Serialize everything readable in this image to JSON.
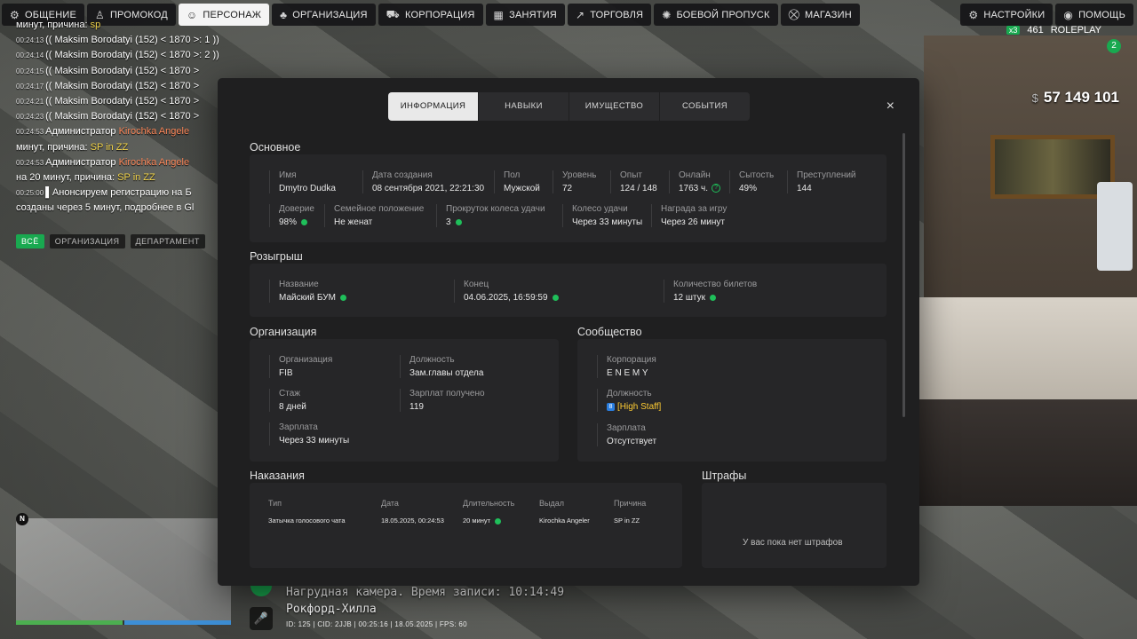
{
  "topbar": {
    "left": [
      {
        "icon": "chat-icon",
        "label": "ОБЩЕНИЕ"
      },
      {
        "icon": "promo-icon",
        "label": "ПРОМОКОД"
      },
      {
        "icon": "user-icon",
        "label": "ПЕРСОНАЖ",
        "active": true
      },
      {
        "icon": "org-icon",
        "label": "ОРГАНИЗАЦИЯ"
      },
      {
        "icon": "car-icon",
        "label": "КОРПОРАЦИЯ"
      },
      {
        "icon": "calendar-icon",
        "label": "ЗАНЯТИЯ"
      },
      {
        "icon": "chart-icon",
        "label": "ТОРГОВЛЯ"
      },
      {
        "icon": "gear-badge-icon",
        "label": "БОЕВОЙ ПРОПУСК"
      },
      {
        "icon": "cart-icon",
        "label": "МАГАЗИН"
      }
    ],
    "right": [
      {
        "icon": "settings-icon",
        "label": "НАСТРОЙКИ"
      },
      {
        "icon": "help-icon",
        "label": "ПОМОЩЬ"
      }
    ]
  },
  "hud": {
    "money_currency": "$",
    "money": "57 149 101",
    "online_left": "x3",
    "online": "461",
    "brand": "ROLEPLAY",
    "badge": "2",
    "bodycam": "Нагрудная камера. Время записи: 10:14:49",
    "location": "Рокфорд-Хилла",
    "sysline": "ID: 125 | CID: 2JJB | 00:25:16 | 18.05.2025 | FPS: 60"
  },
  "chat": {
    "lines": [
      {
        "ts": "",
        "pre": "",
        "mid": "",
        "post": "минут, причина: ",
        "hl": "sp"
      },
      {
        "ts": "00:24:13",
        "pre": "(( Maksim Borodatyi (152) < 1870 >: 1 ))",
        "mid": "",
        "post": "",
        "hl": ""
      },
      {
        "ts": "00:24:14",
        "pre": "(( Maksim Borodatyi (152) < 1870 >: 2 ))",
        "mid": "",
        "post": "",
        "hl": ""
      },
      {
        "ts": "00:24:15",
        "pre": "(( Maksim Borodatyi (152) < 1870 >",
        "mid": "",
        "post": "",
        "hl": ""
      },
      {
        "ts": "00:24:17",
        "pre": "(( Maksim Borodatyi (152) < 1870 >",
        "mid": "",
        "post": "",
        "hl": ""
      },
      {
        "ts": "00:24:21",
        "pre": "(( Maksim Borodatyi (152) < 1870 >",
        "mid": "",
        "post": "",
        "hl": ""
      },
      {
        "ts": "00:24:23",
        "pre": "(( Maksim Borodatyi (152) < 1870 >",
        "mid": "",
        "post": "",
        "hl": ""
      },
      {
        "ts": "00:24:53",
        "pre": "Администратор ",
        "mid": "Kirochka Angele",
        "post": "",
        "hl": ""
      },
      {
        "ts": "",
        "pre": "минут, причина: ",
        "mid": "",
        "post": "",
        "hl": "SP in ZZ"
      },
      {
        "ts": "00:24:53",
        "pre": "Администратор ",
        "mid": "Kirochka Angele",
        "post": "",
        "hl": ""
      },
      {
        "ts": "",
        "pre": "на 20 минут, причина: ",
        "mid": "",
        "post": "",
        "hl": "SP in ZZ"
      },
      {
        "ts": "00:25:00",
        "pre": "▌Анонсируем регистрацию на Б",
        "mid": "",
        "post": "",
        "hl": ""
      },
      {
        "ts": "",
        "pre": "созданы через 5 минут, подробнее в Gl",
        "mid": "",
        "post": "",
        "hl": ""
      }
    ],
    "tabs": [
      "ВСЁ",
      "ОРГАНИЗАЦИЯ",
      "ДЕПАРТАМЕНТ"
    ]
  },
  "modal": {
    "tabs": [
      "ИНФОРМАЦИЯ",
      "НАВЫКИ",
      "ИМУЩЕСТВО",
      "СОБЫТИЯ"
    ],
    "close": "×",
    "basic": {
      "title": "Основное",
      "name": {
        "label": "Имя",
        "value": "Dmytro Dudka"
      },
      "created": {
        "label": "Дата создания",
        "value": "08 сентября 2021, 22:21:30"
      },
      "gender": {
        "label": "Пол",
        "value": "Мужской"
      },
      "level": {
        "label": "Уровень",
        "value": "72"
      },
      "exp": {
        "label": "Опыт",
        "value": "124 / 148"
      },
      "online": {
        "label": "Онлайн",
        "value": "1763 ч."
      },
      "satiety": {
        "label": "Сытость",
        "value": "49%"
      },
      "crimes": {
        "label": "Преступлений",
        "value": "144"
      },
      "trust": {
        "label": "Доверие",
        "value": "98%"
      },
      "family": {
        "label": "Семейное положение",
        "value": "Не женат"
      },
      "spins": {
        "label": "Прокруток колеса удачи",
        "value": "3"
      },
      "wheel": {
        "label": "Колесо удачи",
        "value": "Через 33 минуты"
      },
      "reward": {
        "label": "Награда за игру",
        "value": "Через 26 минут"
      }
    },
    "raffle": {
      "title": "Розыгрыш",
      "name": {
        "label": "Название",
        "value": "Майский БУМ"
      },
      "end": {
        "label": "Конец",
        "value": "04.06.2025, 16:59:59"
      },
      "tickets": {
        "label": "Количество билетов",
        "value": "12 штук"
      }
    },
    "org": {
      "title": "Организация",
      "org": {
        "label": "Организация",
        "value": "FIB"
      },
      "position": {
        "label": "Должность",
        "value": "Зам.главы отдела"
      },
      "tenure": {
        "label": "Стаж",
        "value": "8 дней"
      },
      "salaries": {
        "label": "Зарплат получено",
        "value": "119"
      },
      "salary": {
        "label": "Зарплата",
        "value": "Через 33 минуты"
      }
    },
    "community": {
      "title": "Сообщество",
      "corp": {
        "label": "Корпорация",
        "value": "E N E M Y"
      },
      "position": {
        "label": "Должность",
        "badge": "8",
        "value": "[High Staff]"
      },
      "salary": {
        "label": "Зарплата",
        "value": "Отсутствует"
      }
    },
    "punish": {
      "title": "Наказания",
      "headers": [
        "Тип",
        "Дата",
        "Длительность",
        "Выдал",
        "Причина"
      ],
      "rows": [
        [
          "Затычка голосового чата",
          "18.05.2025, 00:24:53",
          "20 минут",
          "Kirochka Angeler",
          "SP in ZZ"
        ]
      ]
    },
    "fines": {
      "title": "Штрафы",
      "empty": "У вас пока нет штрафов"
    }
  },
  "colors": {
    "accent": "#1fbf5a",
    "panel": "#1f1f20",
    "card": "#262628",
    "staff": "#ffcc33"
  }
}
